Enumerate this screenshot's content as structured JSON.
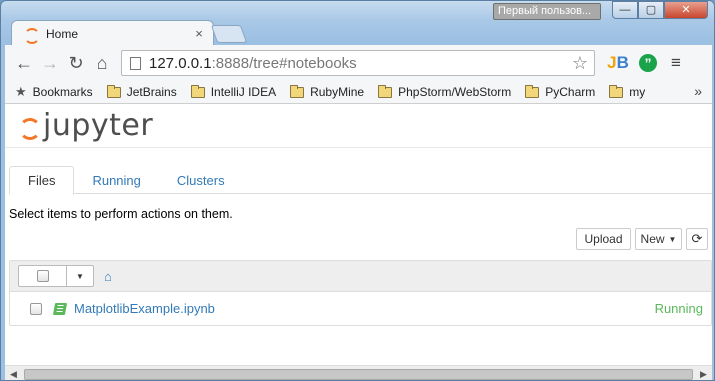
{
  "window": {
    "user_badge": "Первый пользов...",
    "min_label": "—",
    "max_label": "▢",
    "close_label": "✕"
  },
  "tab": {
    "title": "Home",
    "close": "×"
  },
  "toolbar": {
    "back": "←",
    "forward": "→",
    "reload": "↻",
    "home": "⌂",
    "url_host": "127.0.0.1",
    "url_rest": ":8888/tree#notebooks",
    "star": "☆",
    "ext_jb_a": "J",
    "ext_jb_b": "B",
    "ext_quote": "”",
    "menu": "≡"
  },
  "bookmarks": {
    "items": [
      {
        "label": "Bookmarks",
        "icon": "star-icon"
      },
      {
        "label": "JetBrains",
        "icon": "folder-icon"
      },
      {
        "label": "IntelliJ IDEA",
        "icon": "folder-icon"
      },
      {
        "label": "RubyMine",
        "icon": "folder-icon"
      },
      {
        "label": "PhpStorm/WebStorm",
        "icon": "folder-icon"
      },
      {
        "label": "PyCharm",
        "icon": "folder-icon"
      },
      {
        "label": "my",
        "icon": "folder-icon"
      }
    ],
    "more": "»"
  },
  "jupyter": {
    "logo_text": "jupyter",
    "tabs": [
      {
        "label": "Files",
        "active": true
      },
      {
        "label": "Running",
        "active": false
      },
      {
        "label": "Clusters",
        "active": false
      }
    ],
    "hint": "Select items to perform actions on them.",
    "upload_label": "Upload",
    "new_label": "New",
    "refresh_icon": "⟳",
    "home_icon": "⌂",
    "files": [
      {
        "name": "MatplotlibExample.ipynb",
        "status": "Running"
      }
    ]
  }
}
